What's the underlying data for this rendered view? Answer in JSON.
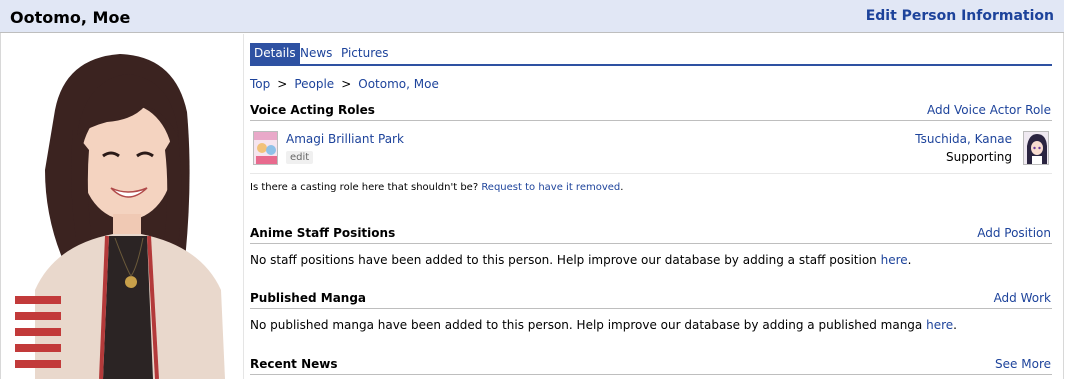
{
  "header": {
    "title": "Ootomo, Moe",
    "edit_link": "Edit Person Information"
  },
  "tabs": [
    {
      "label": "Details",
      "active": true
    },
    {
      "label": "News",
      "active": false
    },
    {
      "label": "Pictures",
      "active": false
    }
  ],
  "breadcrumb": {
    "items": [
      "Top",
      "People",
      "Ootomo, Moe"
    ],
    "separator": ">"
  },
  "voice_roles": {
    "heading": "Voice Acting Roles",
    "action": "Add Voice Actor Role",
    "roles": [
      {
        "anime": "Amagi Brilliant Park",
        "edit_label": "edit",
        "character": "Tsuchida, Kanae",
        "role": "Supporting"
      }
    ],
    "casting_note": "Is there a casting role here that shouldn't be? ",
    "casting_link": "Request to have it removed",
    "casting_end": "."
  },
  "staff": {
    "heading": "Anime Staff Positions",
    "action": "Add Position",
    "text": "No staff positions have been added to this person. Help improve our database by adding a staff position ",
    "link": "here",
    "end": "."
  },
  "manga": {
    "heading": "Published Manga",
    "action": "Add Work",
    "text": "No published manga have been added to this person. Help improve our database by adding a published manga ",
    "link": "here",
    "end": "."
  },
  "news": {
    "heading": "Recent News",
    "action": "See More"
  },
  "colors": {
    "header_bg": "#e1e7f5",
    "link": "#1d439b",
    "tab_active_bg": "#2e51a2"
  }
}
